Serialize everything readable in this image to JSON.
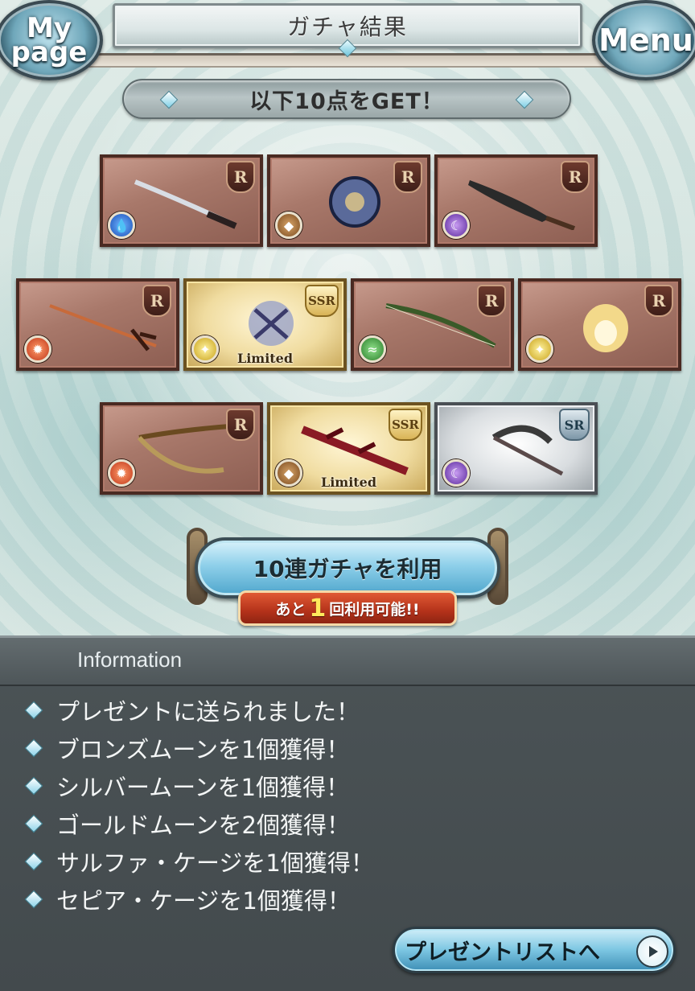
{
  "header": {
    "title": "ガチャ結果",
    "mypage_label_line1": "My",
    "mypage_label_line2": "page",
    "menu_label": "Menu"
  },
  "banner": {
    "text": "以下10点をGET！"
  },
  "cards": [
    {
      "rarity": "R",
      "element": "water",
      "limited": ""
    },
    {
      "rarity": "R",
      "element": "earth",
      "limited": ""
    },
    {
      "rarity": "R",
      "element": "dark",
      "limited": ""
    },
    {
      "rarity": "R",
      "element": "fire",
      "limited": ""
    },
    {
      "rarity": "SSR",
      "element": "light",
      "limited": "Limited"
    },
    {
      "rarity": "R",
      "element": "wind",
      "limited": ""
    },
    {
      "rarity": "R",
      "element": "light",
      "limited": ""
    },
    {
      "rarity": "R",
      "element": "fire",
      "limited": ""
    },
    {
      "rarity": "SSR",
      "element": "earth",
      "limited": "Limited"
    },
    {
      "rarity": "SR",
      "element": "dark",
      "limited": ""
    }
  ],
  "gacha": {
    "button_label": "10連ガチャを利用",
    "remaining_prefix": "あと",
    "remaining_count": "1",
    "remaining_suffix": "回利用可能!!"
  },
  "information": {
    "title": "Information",
    "items": [
      "プレゼントに送られました！",
      "ブロンズムーンを1個獲得！",
      "シルバームーンを1個獲得！",
      "ゴールドムーンを2個獲得！",
      "サルファ・ケージを1個獲得！",
      "セピア・ケージを1個獲得！"
    ]
  },
  "present_button": {
    "label": "プレゼントリストへ"
  },
  "colors": {
    "panel_bg": "#434a4d",
    "accent_blue": "#7cc6e2",
    "remaining_red": "#b4321a"
  }
}
